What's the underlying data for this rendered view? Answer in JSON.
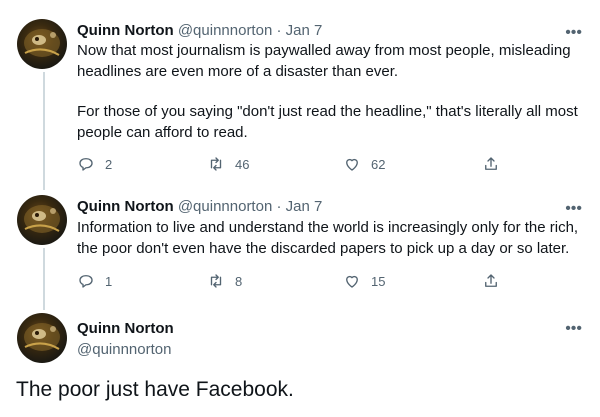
{
  "tweets": [
    {
      "name": "Quinn Norton",
      "handle": "@quinnnorton",
      "date": "Jan 7",
      "paragraphs": [
        "Now that most journalism is paywalled away from most people, misleading headlines are even more of a disaster than ever.",
        "For those of you saying \"don't just read the headline,\" that's literally all most people can afford to read."
      ],
      "replies": "2",
      "retweets": "46",
      "likes": "62"
    },
    {
      "name": "Quinn Norton",
      "handle": "@quinnnorton",
      "date": "Jan 7",
      "paragraphs": [
        "Information to live and understand the world is increasingly only for the rich, the poor don't even have the discarded papers to pick up a day or so later."
      ],
      "replies": "1",
      "retweets": "8",
      "likes": "15"
    }
  ],
  "focused": {
    "name": "Quinn Norton",
    "handle": "@quinnnorton"
  },
  "caption": "The poor just have Facebook.",
  "separator": "·",
  "more_label": "•••",
  "icons": [
    "reply-icon",
    "retweet-icon",
    "like-icon",
    "share-icon",
    "more-icon"
  ]
}
